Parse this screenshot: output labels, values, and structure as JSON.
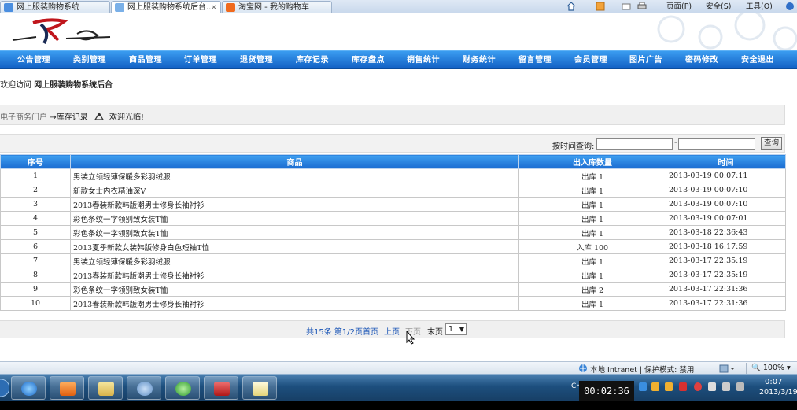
{
  "browser": {
    "tabs": [
      {
        "label": "网上服装购物系统"
      },
      {
        "label": "网上服装购物系统后台..."
      },
      {
        "label": "淘宝网 - 我的购物车"
      }
    ],
    "tab_close_glyph": "×",
    "commands": {
      "page": "页面(P)",
      "safety": "安全(S)",
      "tools": "工具(O)"
    },
    "status": {
      "zone": "本地 Intranet | 保护模式: 禁用",
      "zoom": "100%"
    }
  },
  "nav": {
    "items": [
      "公告管理",
      "类别管理",
      "商品管理",
      "订单管理",
      "退货管理",
      "库存记录",
      "库存盘点",
      "销售统计",
      "财务统计",
      "留言管理",
      "会员管理",
      "图片广告",
      "密码修改",
      "安全退出"
    ]
  },
  "welcome": {
    "prefix": "欢迎访问",
    "site": "网上服装购物系统后台"
  },
  "breadcrumb": {
    "home": "电子商务门户",
    "sep": "→",
    "current": "库存记录",
    "greeting": "欢迎光临!"
  },
  "filter": {
    "label": "按时间查询:",
    "start_value": "",
    "end_value": "",
    "separator": "-",
    "query_button": "查询"
  },
  "table": {
    "headers": [
      "序号",
      "商品",
      "出入库数量",
      "时间"
    ],
    "rows": [
      {
        "no": "1",
        "product": "男装立领轻薄保暖多彩羽绒服",
        "qty": "出库 1",
        "time": "2013-03-19 00:07:11"
      },
      {
        "no": "2",
        "product": "新款女士内衣精油深V",
        "qty": "出库 1",
        "time": "2013-03-19 00:07:10"
      },
      {
        "no": "3",
        "product": "2013春装新款韩版潮男士修身长袖衬衫",
        "qty": "出库 1",
        "time": "2013-03-19 00:07:10"
      },
      {
        "no": "4",
        "product": "彩色条纹一字领别致女装T恤",
        "qty": "出库 1",
        "time": "2013-03-19 00:07:01"
      },
      {
        "no": "5",
        "product": "彩色条纹一字领别致女装T恤",
        "qty": "出库 1",
        "time": "2013-03-18 22:36:43"
      },
      {
        "no": "6",
        "product": "2013夏季新款女装韩版修身白色短袖T恤",
        "qty": "入库 100",
        "time": "2013-03-18 16:17:59"
      },
      {
        "no": "7",
        "product": "男装立领轻薄保暖多彩羽绒服",
        "qty": "出库 1",
        "time": "2013-03-17 22:35:19"
      },
      {
        "no": "8",
        "product": "2013春装新款韩版潮男士修身长袖衬衫",
        "qty": "出库 1",
        "time": "2013-03-17 22:35:19"
      },
      {
        "no": "9",
        "product": "彩色条纹一字领别致女装T恤",
        "qty": "出库 2",
        "time": "2013-03-17 22:31:36"
      },
      {
        "no": "10",
        "product": "2013春装新款韩版潮男士修身长袖衬衫",
        "qty": "出库 1",
        "time": "2013-03-17 22:31:36"
      }
    ]
  },
  "pager": {
    "summary": "共15条 第1/2页",
    "first": "首页",
    "prev": "上页",
    "next": "下页",
    "last": "末页",
    "page_select": "1"
  },
  "taskbar": {
    "ime": "CH",
    "clock_time": "0:07",
    "clock_date": "2013/3/19",
    "timer": "00:02:36"
  },
  "colors": {
    "nav_blue": "#1a6bd0",
    "header_blue": "#3e9ff0",
    "link_blue": "#1a55b6"
  }
}
